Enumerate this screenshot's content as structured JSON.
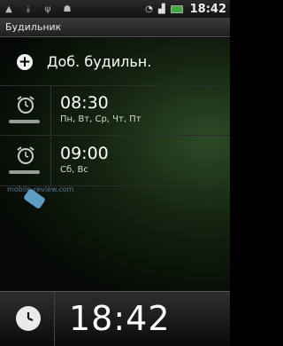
{
  "status_bar": {
    "time": "18:42",
    "icons": [
      "notification-icon",
      "download-icon",
      "usb-icon",
      "debug-icon"
    ]
  },
  "title_bar": {
    "title": "Будильник"
  },
  "add_alarm": {
    "label": "Доб. будильн."
  },
  "alarms": [
    {
      "time": "08:30",
      "days": "Пн, Вт, Ср, Чт, Пт"
    },
    {
      "time": "09:00",
      "days": "Сб, Вс"
    }
  ],
  "watermark": {
    "text": "mobile-review.com"
  },
  "bottom_clock": {
    "time": "18:42"
  },
  "colors": {
    "battery": "#3fa83f",
    "background_green": "#2c4a26",
    "watermark": "#6fb6e6"
  }
}
